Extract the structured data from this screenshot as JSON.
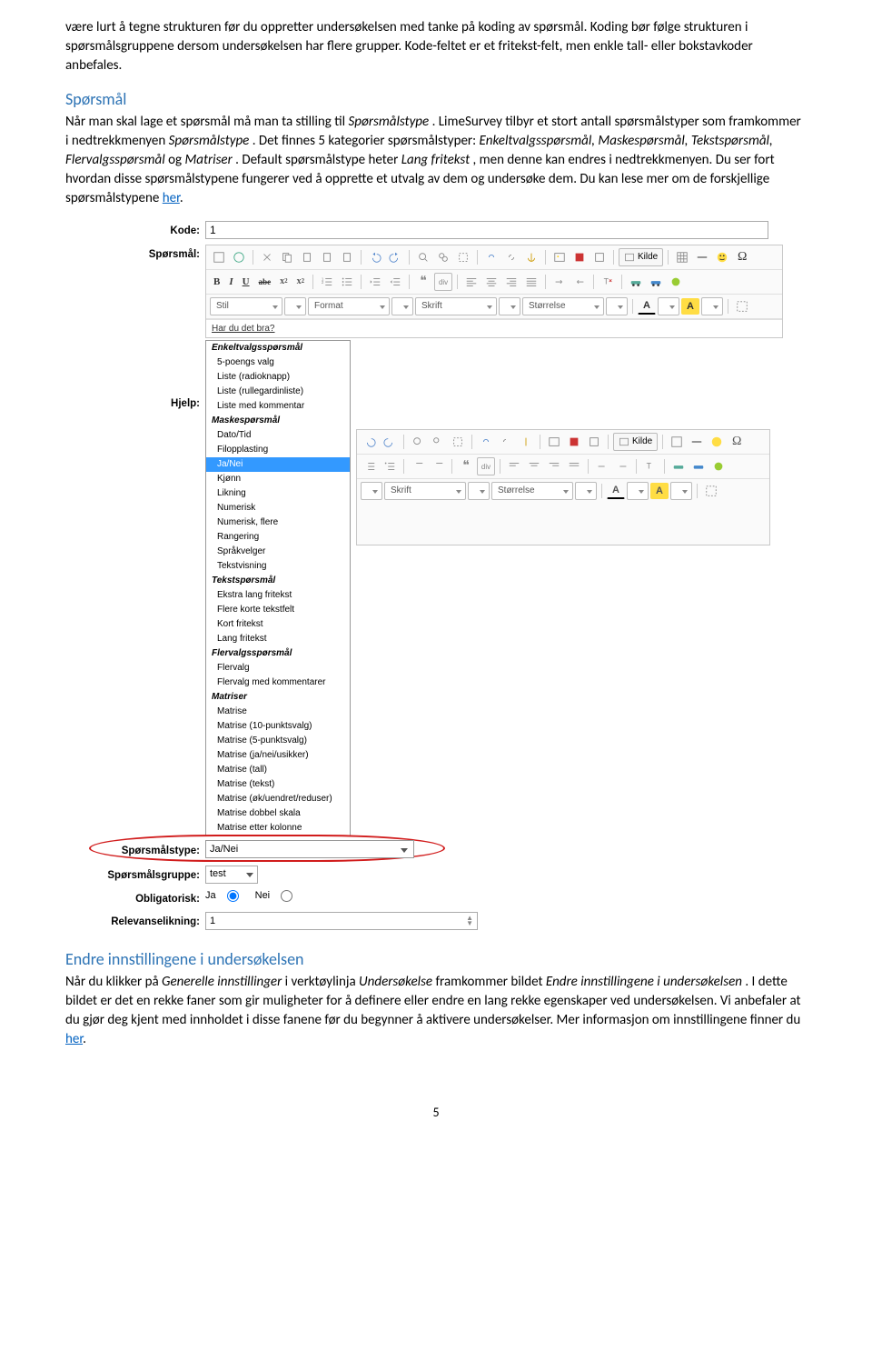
{
  "intro": {
    "p1a": "være lurt å tegne strukturen før du oppretter undersøkelsen med tanke på koding av spørsmål. Koding bør følge strukturen i spørsmålsgruppene dersom undersøkelsen har flere grupper. Kode-feltet er et fritekst-felt, men enkle tall- eller bokstavkoder anbefales."
  },
  "sporsmal_heading": "Spørsmål",
  "sporsmal_para_a": "Når man skal lage et spørsmål må man ta stilling til ",
  "sporsmal_para_b": "Spørsmålstype",
  "sporsmal_para_c": ". LimeSurvey tilbyr et stort antall spørsmålstyper som framkommer i nedtrekkmenyen ",
  "sporsmal_para_d": "Spørsmålstype",
  "sporsmal_para_e": ". Det finnes 5 kategorier spørsmålstyper: ",
  "sporsmal_para_f": "Enkeltvalgsspørsmål, Maskespørsmål, Tekstspørsmål, Flervalgsspørsmål",
  "sporsmal_para_g": " og ",
  "sporsmal_para_h": "Matriser",
  "sporsmal_para_i": ". Default spørsmålstype heter ",
  "sporsmal_para_j": "Lang fritekst",
  "sporsmal_para_k": ", men denne kan endres i nedtrekkmenyen. Du ser fort hvordan disse spørsmålstypene fungerer ved å opprette et utvalg av dem og undersøke dem. Du kan lese mer om de forskjellige spørsmålstypene ",
  "sporsmal_link": "her",
  "sporsmal_para_l": ".",
  "form": {
    "kode_label": "Kode:",
    "kode_value": "1",
    "sporsmal_label": "Spørsmål:",
    "hjelp_label": "Hjelp:",
    "type_label": "Spørsmålstype:",
    "type_value": "Ja/Nei",
    "group_label": "Spørsmålsgruppe:",
    "group_value": "test",
    "oblig_label": "Obligatorisk:",
    "oblig_ja": "Ja",
    "oblig_nei": "Nei",
    "relevans_label": "Relevanselikning:",
    "relevans_value": "1"
  },
  "toolbar": {
    "source_label": "Kilde",
    "stil": "Stil",
    "format": "Format",
    "skrift": "Skrift",
    "storrelse": "Størrelse"
  },
  "editor_hint": "Har du det bra?",
  "listbox": {
    "g1": "Enkeltvalgsspørsmål",
    "g1o1": "5-poengs valg",
    "g1o2": "Liste (radioknapp)",
    "g1o3": "Liste (rullegardinliste)",
    "g1o4": "Liste med kommentar",
    "g2": "Maskespørsmål",
    "g2o1": "Dato/Tid",
    "g2o2": "Filopplasting",
    "g2o3": "Ja/Nei",
    "g2o4": "Kjønn",
    "g2o5": "Likning",
    "g2o6": "Numerisk",
    "g2o7": "Numerisk, flere",
    "g2o8": "Rangering",
    "g2o9": "Språkvelger",
    "g2o10": "Tekstvisning",
    "g3": "Tekstspørsmål",
    "g3o1": "Ekstra lang fritekst",
    "g3o2": "Flere korte tekstfelt",
    "g3o3": "Kort fritekst",
    "g3o4": "Lang fritekst",
    "g4": "Flervalgsspørsmål",
    "g4o1": "Flervalg",
    "g4o2": "Flervalg med kommentarer",
    "g5": "Matriser",
    "g5o1": "Matrise",
    "g5o2": "Matrise (10-punktsvalg)",
    "g5o3": "Matrise (5-punktsvalg)",
    "g5o4": "Matrise (ja/nei/usikker)",
    "g5o5": "Matrise (tall)",
    "g5o6": "Matrise (tekst)",
    "g5o7": "Matrise (øk/uendret/reduser)",
    "g5o8": "Matrise dobbel skala",
    "g5o9": "Matrise etter kolonne"
  },
  "endre_heading": "Endre innstillingene i undersøkelsen",
  "endre_a": "Når du klikker på ",
  "endre_b": "Generelle innstillinger",
  "endre_c": " i verktøylinja ",
  "endre_d": "Undersøkelse",
  "endre_e": " framkommer bildet ",
  "endre_f": "Endre innstillingene i undersøkelsen",
  "endre_g": ". I dette bildet er det en rekke faner som gir muligheter for å definere eller endre en lang rekke egenskaper ved undersøkelsen. Vi anbefaler at du gjør deg kjent med innholdet i disse fanene før du begynner å aktivere undersøkelser. Mer informasjon om innstillingene finner du ",
  "endre_link": "her",
  "endre_h": ".",
  "page_num": "5"
}
